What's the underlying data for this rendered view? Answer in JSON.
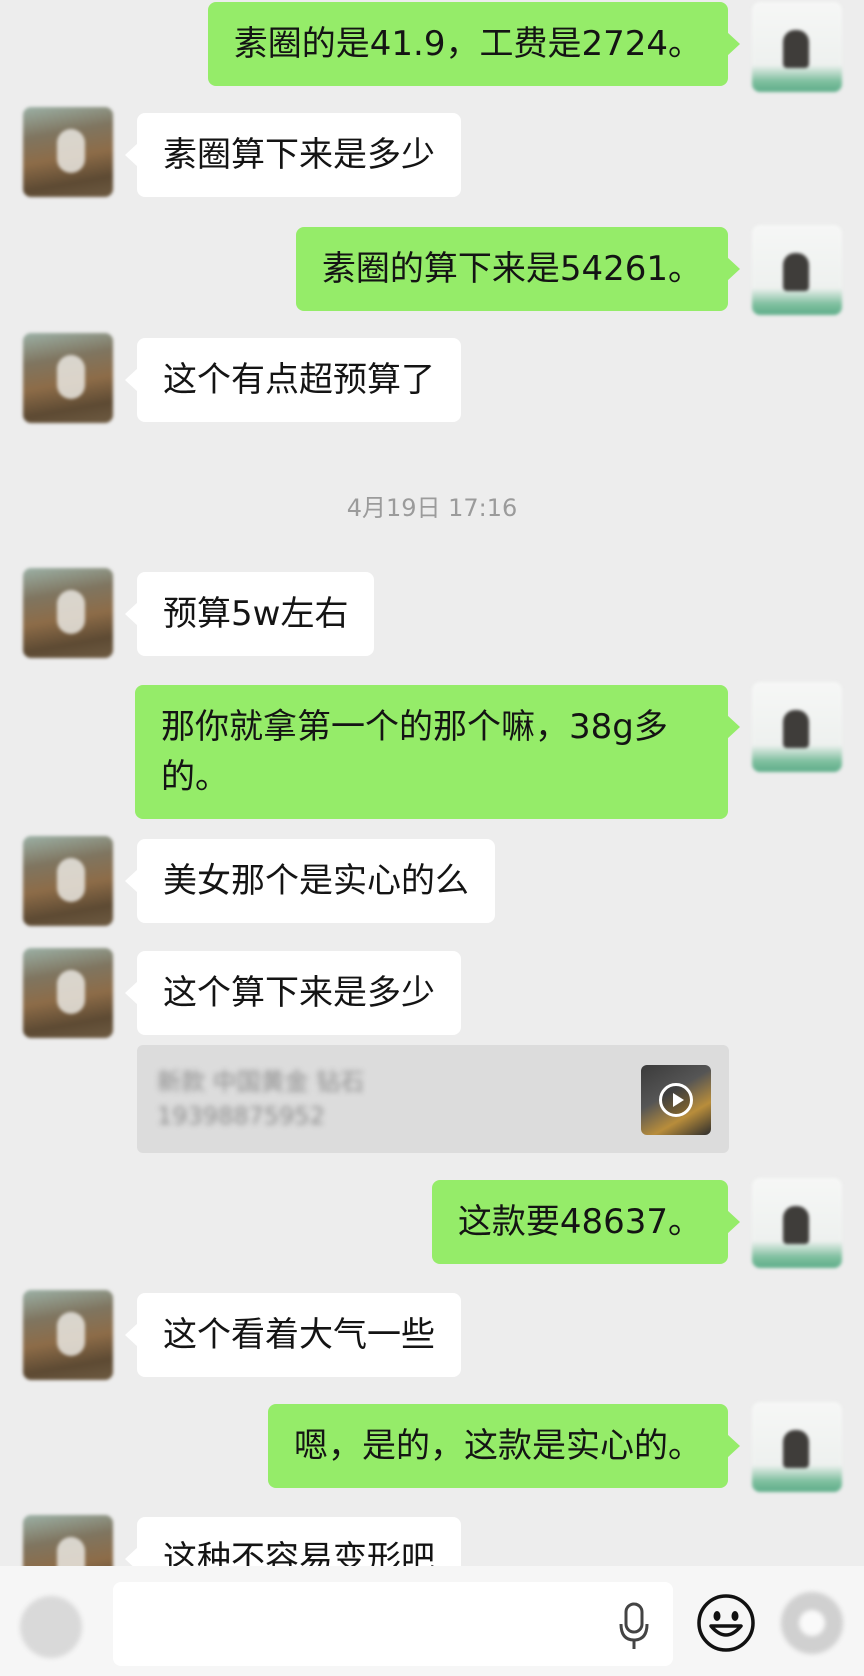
{
  "messages": [
    {
      "from": "self",
      "text": "素圈的是41.9，工费是2724。"
    },
    {
      "from": "other",
      "text": "素圈算下来是多少"
    },
    {
      "from": "self",
      "text": "素圈的算下来是54261。"
    },
    {
      "from": "other",
      "text": "这个有点超预算了"
    },
    {
      "from": "other",
      "text": "预算5w左右"
    },
    {
      "from": "self",
      "text": "那你就拿第一个的那个嘛，38g多的。"
    },
    {
      "from": "other",
      "text": "美女那个是实心的么"
    },
    {
      "from": "other",
      "text": "这个算下来是多少"
    },
    {
      "from": "self",
      "text": "这款要48637。"
    },
    {
      "from": "other",
      "text": "这个看着大气一些"
    },
    {
      "from": "self",
      "text": "嗯，是的，这款是实心的。"
    },
    {
      "from": "other",
      "text": "这种不容易变形吧"
    }
  ],
  "timestamp": "4月19日 17:16",
  "quote": {
    "line1": "新款 中国黄金 钻石",
    "line2": "19398875952"
  },
  "colors": {
    "background": "#ededed",
    "self_bubble": "#95ec69",
    "other_bubble": "#ffffff",
    "timestamp": "#9b9b9b"
  },
  "input_bar": {
    "mic_icon": "microphone-icon",
    "emoji_icon": "smiley-face-icon",
    "plus_icon": "plus-circle-icon"
  }
}
